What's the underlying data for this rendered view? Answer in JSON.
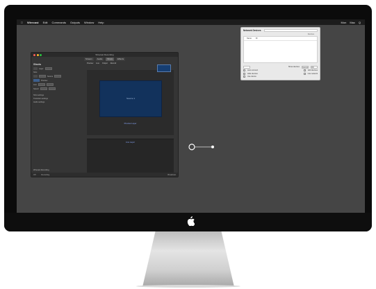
{
  "menubar": {
    "app_name": "Wirecast",
    "items": [
      "Edit",
      "Commands",
      "Outputs",
      "Window",
      "Help"
    ],
    "right_items": [
      "Mon",
      "Mac",
      "Q"
    ]
  },
  "main_window": {
    "title": "Wirecast Recording",
    "toolbar_tabs": [
      "Stream",
      "Audio",
      "Shots",
      "Effects"
    ],
    "selected_tab": "Shots",
    "left_panel": {
      "heading": "Shots",
      "rows": [
        "Layer",
        "Shot",
        "Source",
        "Preview",
        "Live",
        "Speed",
        "Layout",
        "Group"
      ],
      "note_lines": [
        "Shot settings",
        "Transition settings",
        "Audio settings"
      ]
    },
    "center_labels": [
      "Preview",
      "Live",
      "Output",
      "Record"
    ],
    "preview_label": "Source 1",
    "preview_caption": "Preview Layer",
    "live_caption": "Live Layer",
    "footer": "Wirecast Recording",
    "status_left": "Off",
    "status_mid": "Recording",
    "status_right": "Broadcast"
  },
  "dialog": {
    "title": "Network Devices",
    "subtitle": "Devices",
    "list_headers": [
      "Name",
      "ID"
    ],
    "options": [
      "Show devices",
      "Auto connect",
      "Add devices",
      "Hide devices",
      "Use network",
      "Use device"
    ],
    "buttons": [
      "Cancel",
      "OK"
    ]
  },
  "colors": {
    "screen": "#454545",
    "menubar": "#1c1c1c",
    "preview_blue": "#12325c",
    "accent_text": "#8aa9ff"
  }
}
